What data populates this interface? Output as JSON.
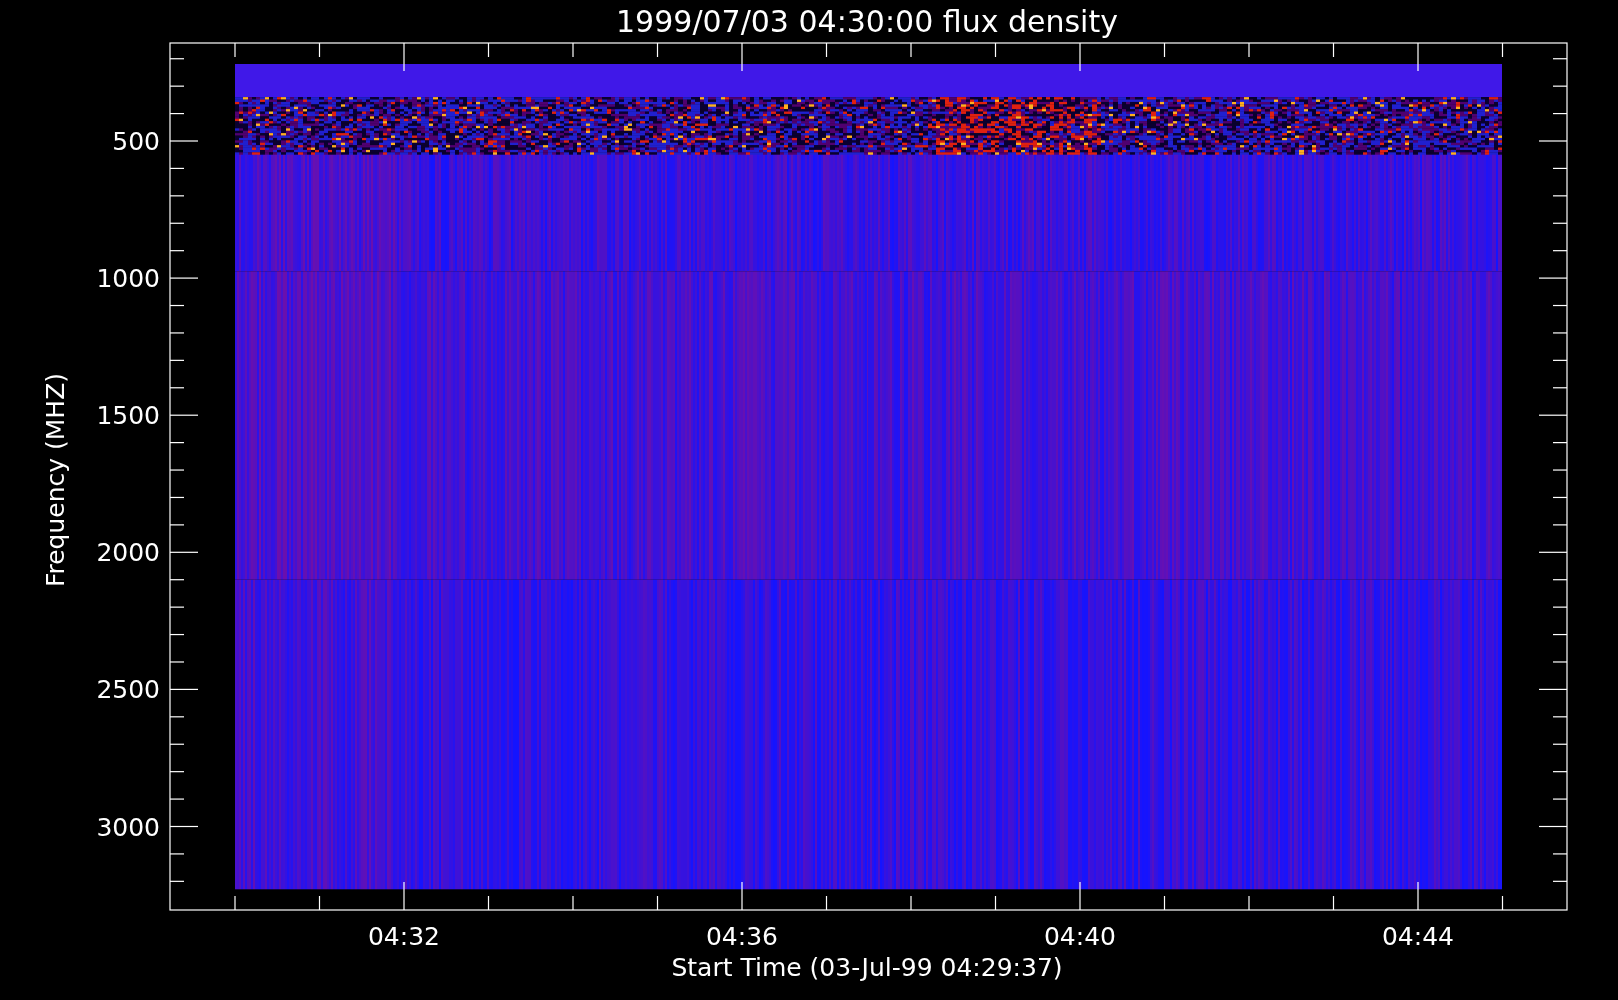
{
  "plot": {
    "title": "1999/07/03 04:30:00 flux density",
    "xlabel": "Start Time (03-Jul-99 04:29:37)",
    "ylabel": "Frequency (MHZ)",
    "xticks": [
      "04:32",
      "04:36",
      "04:40",
      "04:44"
    ],
    "yticks": [
      "500",
      "1000",
      "1500",
      "2000",
      "2500",
      "3000"
    ]
  }
}
